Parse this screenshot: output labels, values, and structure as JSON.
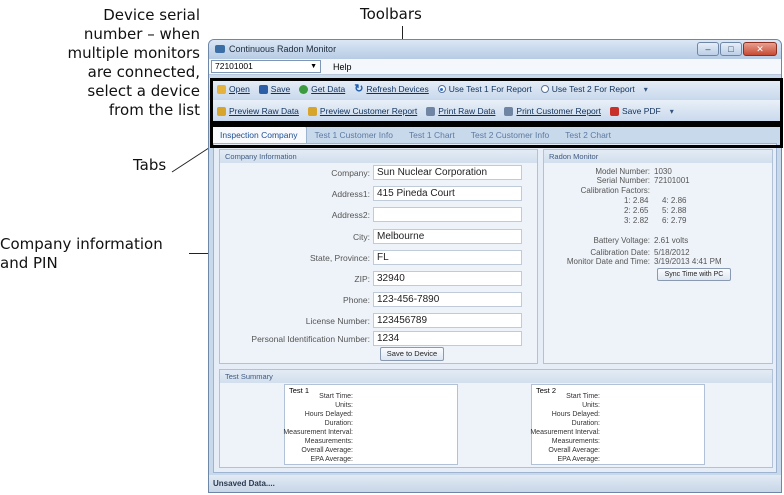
{
  "callouts": {
    "serial_lines": [
      "Device serial",
      "number – when",
      "multiple monitors",
      "are connected,",
      "select a device",
      "from the list"
    ],
    "toolbars": "Toolbars",
    "tabs": "Tabs",
    "company_lines": [
      "Company information",
      "and PIN"
    ]
  },
  "window": {
    "title": "Continuous Radon Monitor",
    "minimize": "–",
    "maximize": "□",
    "close": "✕"
  },
  "menu": {
    "device_serial": "72101001",
    "help": "Help"
  },
  "toolbar1": {
    "open": "Open",
    "save": "Save",
    "get_data": "Get Data",
    "refresh": "Refresh Devices",
    "use_test1": "Use Test 1 For Report",
    "use_test2": "Use Test 2 For Report",
    "test1_selected": true
  },
  "toolbar2": {
    "preview_raw": "Preview Raw Data",
    "preview_customer": "Preview Customer Report",
    "print_raw": "Print Raw Data",
    "print_customer": "Print Customer Report",
    "save_pdf": "Save PDF"
  },
  "tabs": [
    "Inspection Company",
    "Test 1 Customer Info",
    "Test 1 Chart",
    "Test 2 Customer Info",
    "Test 2 Chart"
  ],
  "company": {
    "title": "Company Information",
    "fields": [
      {
        "label": "Company:",
        "value": "Sun Nuclear Corporation"
      },
      {
        "label": "Address1:",
        "value": "415 Pineda Court"
      },
      {
        "label": "Address2:",
        "value": ""
      },
      {
        "label": "City:",
        "value": "Melbourne"
      },
      {
        "label": "State, Province:",
        "value": "FL"
      },
      {
        "label": "ZIP:",
        "value": "32940"
      },
      {
        "label": "Phone:",
        "value": "123-456-7890"
      },
      {
        "label": "License Number:",
        "value": "123456789"
      },
      {
        "label": "Personal Identification Number:",
        "value": "1234"
      }
    ],
    "save_button": "Save to Device"
  },
  "radon": {
    "title": "Radon Monitor",
    "model_label": "Model Number:",
    "model_value": "1030",
    "serial_label": "Serial Number:",
    "serial_value": "72101001",
    "cal_label": "Calibration Factors:",
    "cal_left": [
      "1: 2.84",
      "2: 2.65",
      "3: 2.82"
    ],
    "cal_right": [
      "4: 2.86",
      "5: 2.88",
      "6: 2.79"
    ],
    "battery_label": "Battery Voltage:",
    "battery_value": "2.61 volts",
    "caldate_label": "Calibration Date:",
    "caldate_value": "5/18/2012",
    "monitor_label": "Monitor Date and Time:",
    "monitor_value": "3/19/2013 4:41 PM",
    "sync_button": "Sync Time with PC"
  },
  "summary": {
    "title": "Test Summary",
    "test1_title": "Test 1",
    "test2_title": "Test 2",
    "lines": [
      "Start Time:",
      "Units:",
      "Hours Delayed:",
      "Duration:",
      "Measurement Interval:",
      "Measurements:",
      "Overall Average:",
      "EPA Average:"
    ]
  },
  "status": "Unsaved Data...."
}
